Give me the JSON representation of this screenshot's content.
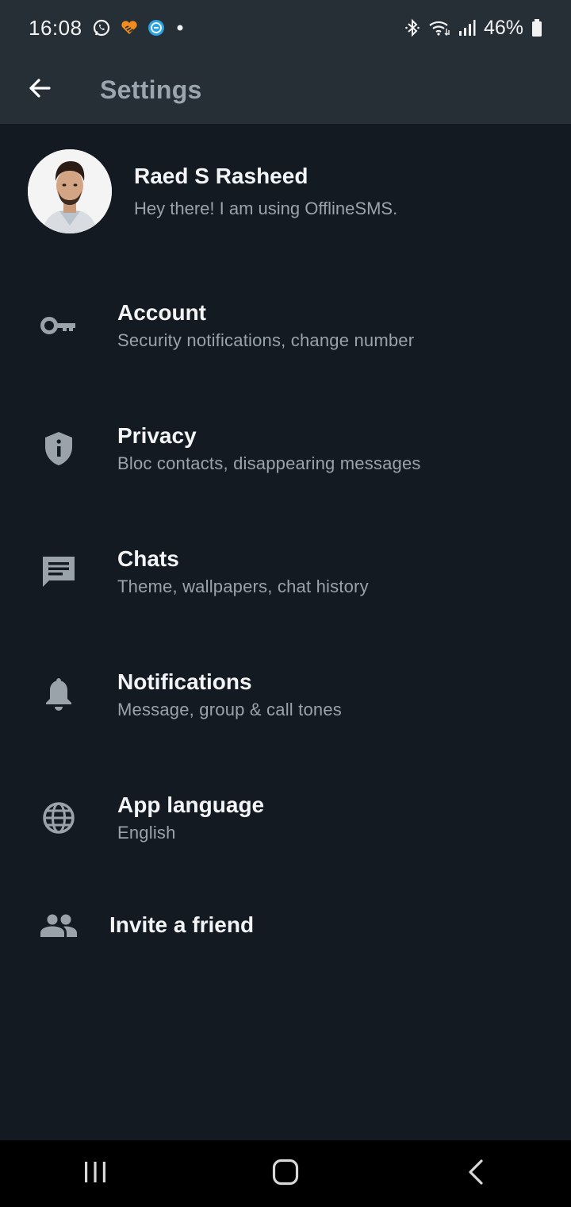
{
  "status_bar": {
    "time": "16:08",
    "battery": "46%",
    "notification_icons": [
      "whatsapp-icon",
      "app-heart-icon",
      "app-blue-icon",
      "dot-icon"
    ],
    "system_icons": [
      "bluetooth-icon",
      "wifi-icon",
      "signal-icon",
      "battery-icon"
    ]
  },
  "app_bar": {
    "title": "Settings"
  },
  "profile": {
    "name": "Raed S Rasheed",
    "status": "Hey there! I am using OfflineSMS."
  },
  "settings": {
    "items": [
      {
        "icon": "key-icon",
        "title": "Account",
        "subtitle": "Security notifications, change number"
      },
      {
        "icon": "shield-icon",
        "title": "Privacy",
        "subtitle": "Bloc contacts, disappearing messages"
      },
      {
        "icon": "chat-icon",
        "title": "Chats",
        "subtitle": "Theme, wallpapers, chat history"
      },
      {
        "icon": "bell-icon",
        "title": "Notifications",
        "subtitle": "Message, group & call tones"
      },
      {
        "icon": "globe-icon",
        "title": "App language",
        "subtitle": "English"
      }
    ],
    "invite": {
      "icon": "people-icon",
      "label": "Invite a friend"
    }
  },
  "colors": {
    "background": "#141a21",
    "header": "#252f35",
    "primary_text": "#f3f4f5",
    "secondary_text": "#9aa3aa",
    "icon": "#9aa3aa"
  }
}
